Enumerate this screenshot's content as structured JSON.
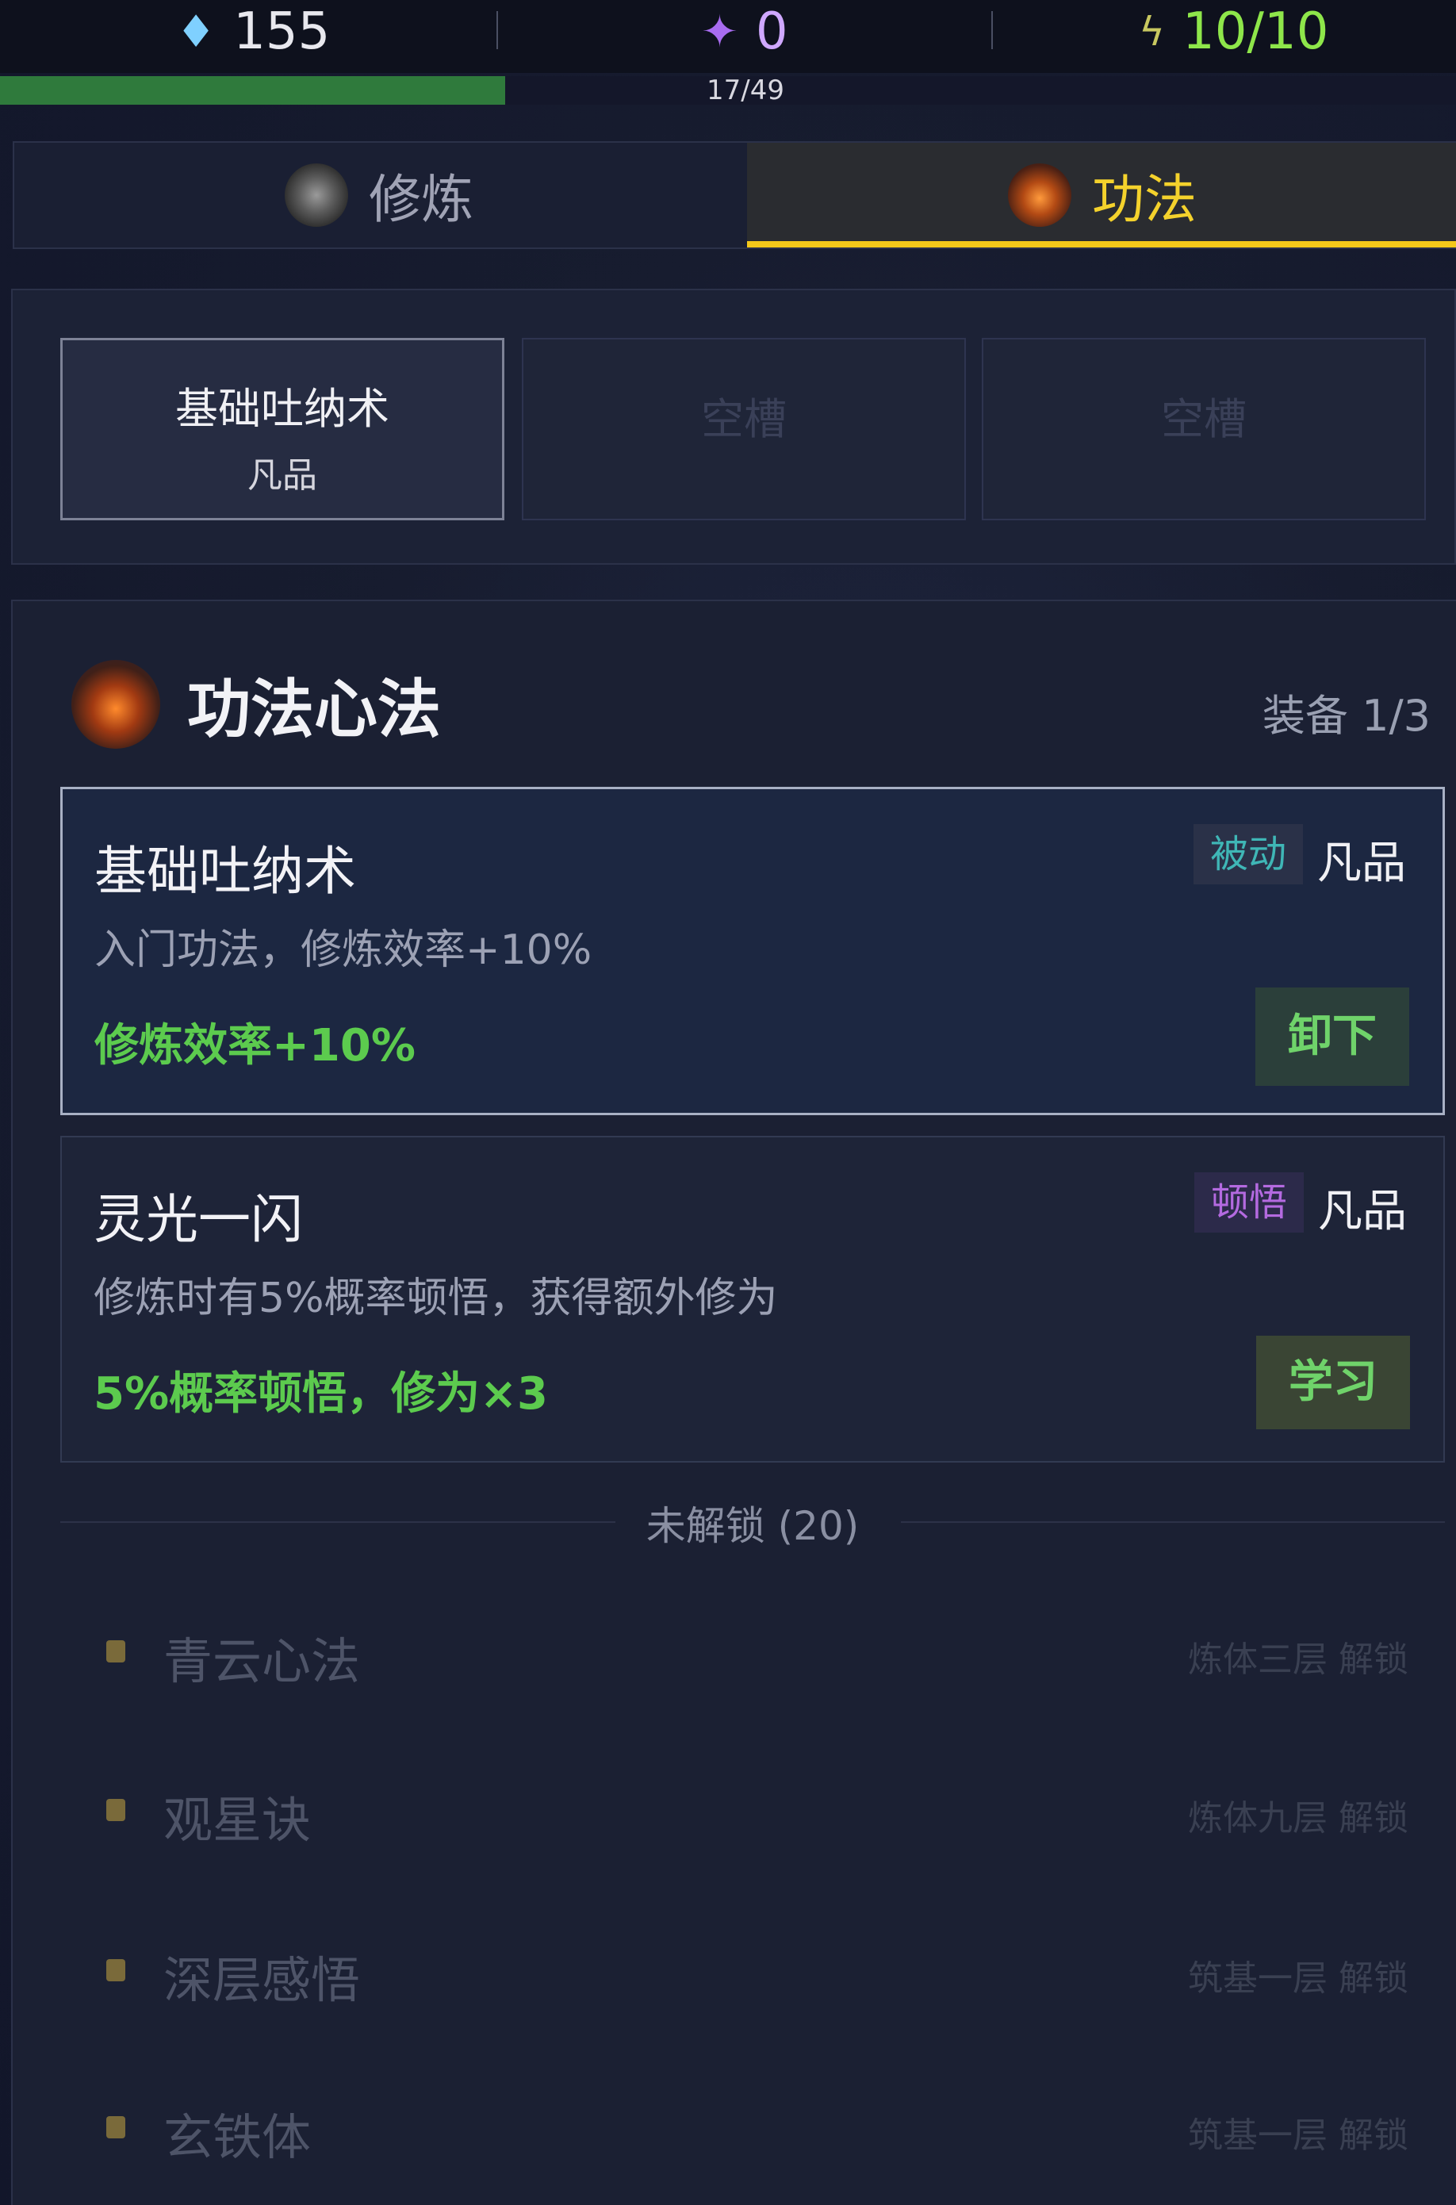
{
  "resources": {
    "spirit_stones": "155",
    "purple_crystals": "0",
    "energy": "10/10",
    "spirit_stone_icon": "blue-crystal-icon",
    "purple_crystal_icon": "purple-star-icon",
    "energy_icon": "lightning-icon"
  },
  "progress": {
    "text": "17/49",
    "value": 0.347,
    "color": "#2f7a3c"
  },
  "tabs": [
    {
      "label": "修炼",
      "active": false
    },
    {
      "label": "功法",
      "active": true
    }
  ],
  "slots": [
    {
      "name": "基础吐纳术",
      "grade": "凡品",
      "filled": true
    },
    {
      "name": "空槽",
      "filled": false
    },
    {
      "name": "空槽",
      "filled": false
    }
  ],
  "panel": {
    "title": "功法心法",
    "equip_count": "装备 1/3"
  },
  "techniques": [
    {
      "name": "基础吐纳术",
      "type": "被动",
      "grade": "凡品",
      "description": "入门功法，修炼效率+10%",
      "effect": "修炼效率+10%",
      "action": "卸下"
    },
    {
      "name": "灵光一闪",
      "type": "顿悟",
      "grade": "凡品",
      "description": "修炼时有5%概率顿悟，获得额外修为",
      "effect": "5%概率顿悟，修为×3",
      "action": "学习"
    }
  ],
  "locked": {
    "label": "未解锁 (20)",
    "items": [
      {
        "name": "青云心法",
        "requirement": "炼体三层 解锁"
      },
      {
        "name": "观星诀",
        "requirement": "炼体九层 解锁"
      },
      {
        "name": "深层感悟",
        "requirement": "筑基一层 解锁"
      },
      {
        "name": "玄铁体",
        "requirement": "筑基一层 解锁"
      }
    ]
  },
  "colors": {
    "accent": "#f4c81a",
    "effect_green": "#5ccb4e",
    "passive_teal": "#3fb6b6",
    "insight_purple": "#b46ae0"
  }
}
